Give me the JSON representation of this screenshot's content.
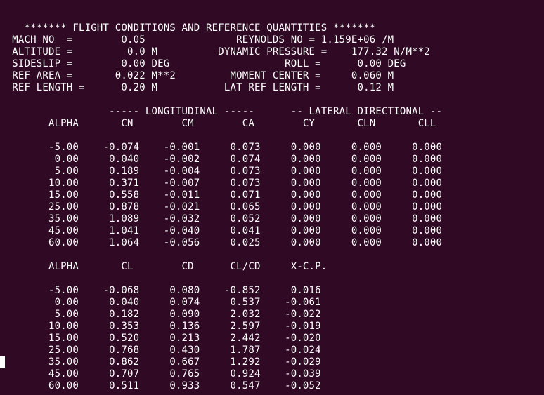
{
  "window": {
    "background": "#300a24",
    "foreground": "#ffffff"
  },
  "terminal": {
    "lines": [
      "",
      "    ******* FLIGHT CONDITIONS AND REFERENCE QUANTITIES *******",
      "  MACH NO  =        0.05               REYNOLDS NO = 1.159E+06 /M",
      "  ALTITUDE =         0.0 M          DYNAMIC PRESSURE =    177.32 N/M**2",
      "  SIDESLIP =        0.00 DEG                   ROLL =      0.00 DEG",
      "  REF AREA =       0.022 M**2         MOMENT CENTER =     0.060 M",
      "  REF LENGTH =      0.20 M           LAT REF LENGTH =      0.12 M",
      "",
      "                  ----- LONGITUDINAL -----      -- LATERAL DIRECTIONAL --",
      "        ALPHA       CN        CM        CA        CY       CLN       CLL",
      "",
      "        -5.00    -0.074    -0.001     0.073     0.000     0.000     0.000",
      "         0.00     0.040    -0.002     0.074     0.000     0.000     0.000",
      "         5.00     0.189    -0.004     0.073     0.000     0.000     0.000",
      "        10.00     0.371    -0.007     0.073     0.000     0.000     0.000",
      "        15.00     0.558    -0.011     0.071     0.000     0.000     0.000",
      "        25.00     0.878    -0.021     0.065     0.000     0.000     0.000",
      "        35.00     1.089    -0.032     0.052     0.000     0.000     0.000",
      "        45.00     1.041    -0.040     0.041     0.000     0.000     0.000",
      "        60.00     1.064    -0.056     0.025     0.000     0.000     0.000",
      "",
      "        ALPHA       CL        CD      CL/CD     X-C.P.",
      "",
      "        -5.00    -0.068     0.080    -0.852     0.016",
      "         0.00     0.040     0.074     0.537    -0.061",
      "         5.00     0.182     0.090     2.032    -0.022",
      "        10.00     0.353     0.136     2.597    -0.019",
      "        15.00     0.520     0.213     2.442    -0.020",
      "        25.00     0.768     0.430     1.787    -0.024",
      "        35.00     0.862     0.667     1.292    -0.029",
      "        45.00     0.707     0.765     0.924    -0.039",
      "        60.00     0.511     0.933     0.547    -0.052",
      ""
    ]
  }
}
